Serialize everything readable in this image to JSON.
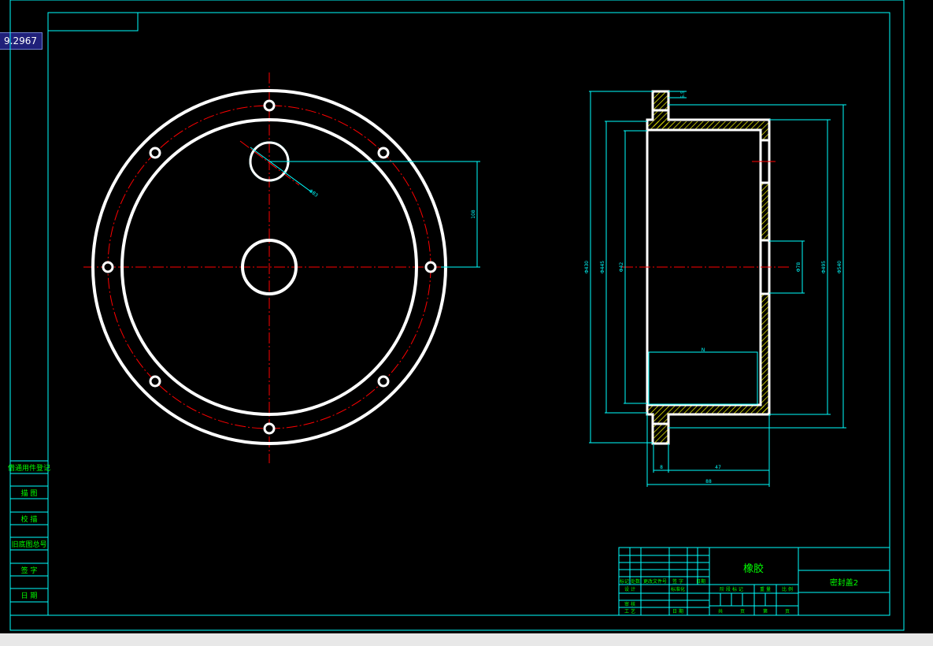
{
  "coordinate_readout": "9.2967",
  "left_sidebar": {
    "rows": [
      "借通用件登记",
      "描 图",
      "校 描",
      "旧底图总号",
      "签 字",
      "日 期"
    ]
  },
  "dimensions": {
    "hole_dia": "Φ83",
    "vertical_offset": "108",
    "overall_height_left": "Φ430",
    "inner_height_a": "Φ445",
    "inner_height_b": "Φ42",
    "top_flange": "5.5",
    "port_height": "Φ78",
    "right_height_a": "Φ495",
    "right_height_b": "Φ540",
    "inner_box": "N",
    "bottom_width_a": "8",
    "bottom_width_b": "47",
    "total_width": "88"
  },
  "title_block": {
    "material": "橡胶",
    "drawing_name": "密封盖2",
    "headers": [
      "标记",
      "处数",
      "更改文件号",
      "签 字",
      "日期"
    ],
    "left_rows": [
      "设 计",
      "审 核",
      "工 艺"
    ],
    "left_mid": [
      "标准化",
      "日 期"
    ],
    "stage_headers": [
      "阶 段 标 记",
      "重 量",
      "比 例"
    ],
    "sheet_labels": [
      "共",
      "页",
      "第",
      "页"
    ]
  },
  "colors": {
    "outline": "#ffffff",
    "centerline": "#ff0000",
    "dimension": "#00ffff",
    "text": "#00ff00",
    "frame": "#00ffff",
    "hatch": "#ffff00"
  }
}
